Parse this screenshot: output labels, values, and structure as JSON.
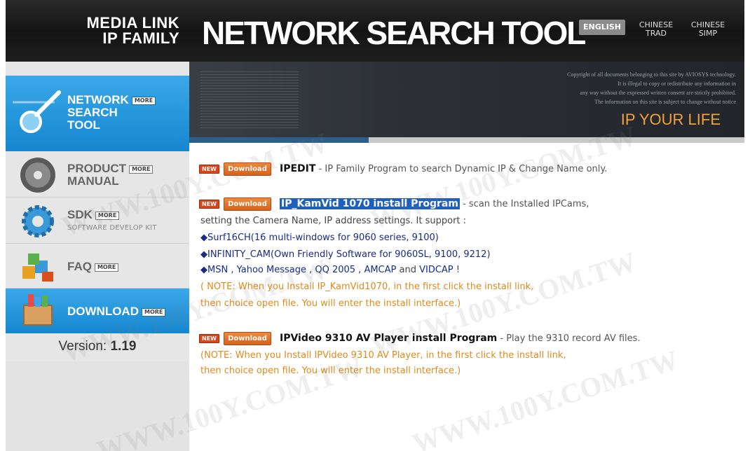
{
  "header": {
    "logo_line1": "MEDIA LINK",
    "logo_line2": "IP FAMILY",
    "title": "NETWORK SEARCH TOOL",
    "lang_english": "ENGLISH",
    "lang_trad_1": "CHINESE",
    "lang_trad_2": "TRAD",
    "lang_simp_1": "CHINESE",
    "lang_simp_2": "SIMP"
  },
  "banner": {
    "copyright_1": "Copyright of all documents belonging to this site by AVIOSYS technology.",
    "copyright_2": "It is illegal to copy or redistribute any information in",
    "copyright_3": "any way without the expressed written consent are strictly prohibited.",
    "copyright_4": "The information on this site is subject to change without notice",
    "tagline": "IP YOUR LIFE"
  },
  "sidebar": {
    "more": "MORE",
    "items": [
      {
        "label_1": "NETWORK",
        "label_2": "SEARCH",
        "label_3": "TOOL"
      },
      {
        "label_1": "PRODUCT",
        "label_2": "MANUAL"
      },
      {
        "label_1": "SDK",
        "sub": "SOFTWARE DEVELOP KIT"
      },
      {
        "label_1": "FAQ"
      },
      {
        "label_1": "DOWNLOAD"
      }
    ],
    "version_label": "Version:",
    "version_value": "1.19"
  },
  "content": {
    "new": "NEW",
    "download": "Download",
    "entries": [
      {
        "name": "IPEDIT",
        "desc": " -  IP Family Program to search Dynamic IP & Change Name only."
      },
      {
        "name": "IP_KamVid 1070 install Program",
        "desc": " -  scan the Installed IPCams,",
        "line2": "setting the Camera Name, IP address settings. It support :",
        "bullet1": "◆Surf16CH(16 multi-windows for 9060 series, 9100)",
        "bullet2": "◆INFINITY_CAM(Own Friendly Software for 9060SL, 9100, 9212)",
        "bullet3_pre": "◆MSN , Yahoo Message , QQ 2005 , ",
        "bullet3_amcap": "AMCAP",
        "bullet3_mid": " and ",
        "bullet3_vidcap": "VIDCAP",
        "bullet3_end": " !",
        "note1": "( NOTE: When you Install IP_KamVid1070, in the first click the install link,",
        "note2": " then choice open file. You will enter the install interface.)"
      },
      {
        "name": "IPVideo 9310 AV Player install Program",
        "desc": " -  Play  the 9310 record AV files.",
        "note1": "(NOTE: When you Install IPVideo 9310 AV Player, in the first click the install link,",
        "note2": "then choice open file. You will enter the install interface.)"
      }
    ]
  },
  "watermark": "WWW.100Y.COM.TW",
  "colors": {
    "header_bg": "#141414",
    "sidebar_active": "#1587d1",
    "note_orange": "#e08a1a",
    "bullet_blue": "#1a2a8a",
    "highlight": "#1f5fc0",
    "tagline_orange": "#f0a03c"
  }
}
